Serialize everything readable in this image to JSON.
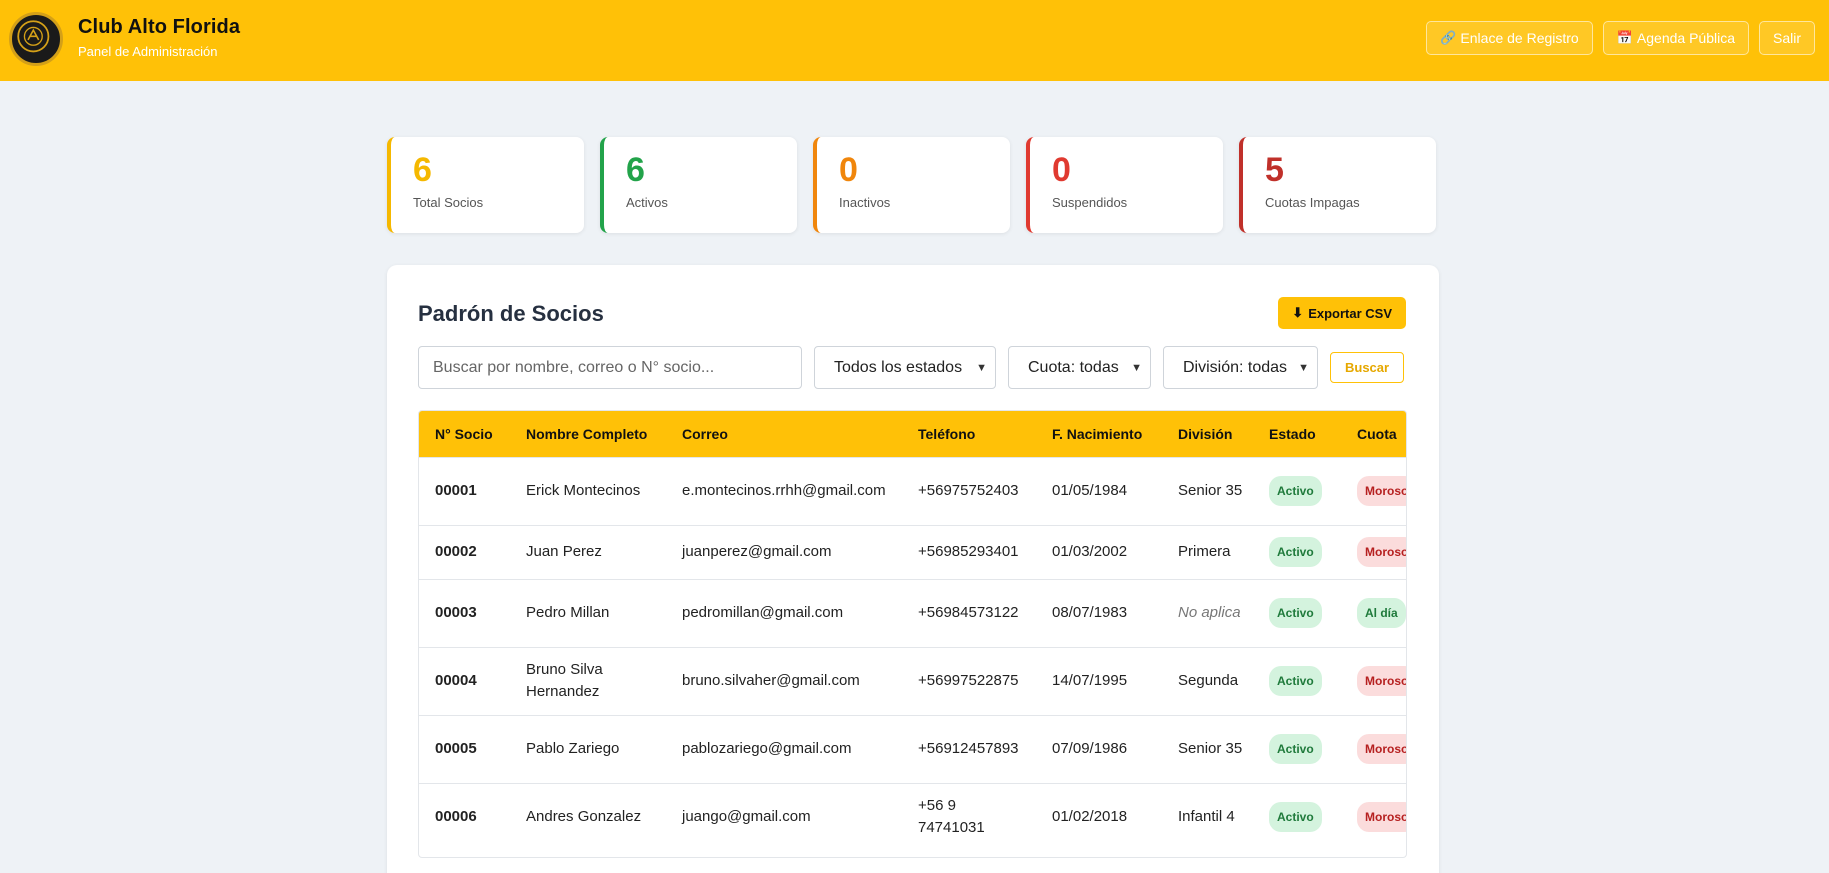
{
  "header": {
    "title": "Club Alto Florida",
    "subtitle": "Panel de Administración",
    "buttons": [
      {
        "icon": "link-icon",
        "glyph": "🔗",
        "label": "Enlace de Registro"
      },
      {
        "icon": "calendar-icon",
        "glyph": "📅",
        "label": "Agenda Pública"
      },
      {
        "label": "Salir"
      }
    ]
  },
  "stats": [
    {
      "value": "6",
      "label": "Total Socios",
      "color": "#f5b800"
    },
    {
      "value": "6",
      "label": "Activos",
      "color": "#22a34a"
    },
    {
      "value": "0",
      "label": "Inactivos",
      "color": "#f0860c"
    },
    {
      "value": "0",
      "label": "Suspendidos",
      "color": "#e03a30"
    },
    {
      "value": "5",
      "label": "Cuotas Impagas",
      "color": "#c0302a"
    }
  ],
  "panel": {
    "title": "Padrón de Socios",
    "export_label": "Exportar CSV",
    "export_glyph": "⬇",
    "search_placeholder": "Buscar por nombre, correo o N° socio...",
    "filters": {
      "estado": "Todos los estados",
      "cuota": "Cuota: todas",
      "division": "División: todas"
    },
    "buscar_label": "Buscar"
  },
  "table": {
    "columns": [
      "N° Socio",
      "Nombre Completo",
      "Correo",
      "Teléfono",
      "F. Nacimiento",
      "División",
      "Estado",
      "Cuota"
    ],
    "rows": [
      {
        "num": "00001",
        "name": "Erick Montecinos",
        "email": "e.montecinos.rrhh@gmail.com",
        "phone": "+56975752403",
        "birth": "01/05/1984",
        "division": "Senior 35",
        "division_na": false,
        "estado": "Activo",
        "cuota": "Moroso",
        "cuota_status": "moroso"
      },
      {
        "num": "00002",
        "name": "Juan Perez",
        "email": "juanperez@gmail.com",
        "phone": "+56985293401",
        "birth": "01/03/2002",
        "division": "Primera",
        "division_na": false,
        "estado": "Activo",
        "cuota": "Moroso",
        "cuota_status": "moroso"
      },
      {
        "num": "00003",
        "name": "Pedro Millan",
        "email": "pedromillan@gmail.com",
        "phone": "+56984573122",
        "birth": "08/07/1983",
        "division": "No aplica",
        "division_na": true,
        "estado": "Activo",
        "cuota": "Al día",
        "cuota_status": "ok"
      },
      {
        "num": "00004",
        "name": "Bruno Silva Hernandez",
        "email": "bruno.silvaher@gmail.com",
        "phone": "+56997522875",
        "birth": "14/07/1995",
        "division": "Segunda",
        "division_na": false,
        "estado": "Activo",
        "cuota": "Moroso",
        "cuota_status": "moroso"
      },
      {
        "num": "00005",
        "name": "Pablo Zariego",
        "email": "pablozariego@gmail.com",
        "phone": "+56912457893",
        "birth": "07/09/1986",
        "division": "Senior 35",
        "division_na": false,
        "estado": "Activo",
        "cuota": "Moroso",
        "cuota_status": "moroso"
      },
      {
        "num": "00006",
        "name": "Andres Gonzalez",
        "email": "juango@gmail.com",
        "phone": "+56 9 74741031",
        "birth": "01/02/2018",
        "division": "Infantil 4",
        "division_na": false,
        "estado": "Activo",
        "cuota": "Moroso",
        "cuota_status": "moroso"
      }
    ]
  }
}
